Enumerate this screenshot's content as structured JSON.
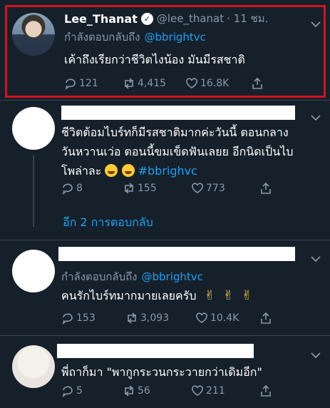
{
  "tweets": [
    {
      "name": "Lee_Thanat",
      "handle": "@lee_thanat",
      "time": "· 11 ชม.",
      "replying_prefix": "กำลังตอบกลับถึง",
      "replying_to": "@bbrightvc",
      "text": "เค้าถึงเรียกว่าชีวิตไงน้อง มันมีรสชาติ",
      "replies": "121",
      "retweets": "4,415",
      "likes": "16.8K"
    },
    {
      "text_line1": "ชีวิตต้อมไบร์ทก็มีรสชาติมากค่ะวันนี้ ตอนกลาง",
      "text_line2": "วันหวานเว่อ ตอนนี้ขมเข็ดฟันเลยย อีกนิดเป็นไบ",
      "text_line3": "โพล่าละ",
      "hashtag": "#bbrighvc",
      "replies": "8",
      "retweets": "155",
      "likes": "773",
      "more_replies": "อีก 2 การตอบกลับ"
    },
    {
      "replying_prefix": "กำลังตอบกลับถึง",
      "replying_to": "@bbrightvc",
      "text": "คนรักไบร์ทมากมายเลยครับ",
      "hand_emoji": "✌",
      "replies": "153",
      "retweets": "3,093",
      "likes": "10.4K"
    },
    {
      "text": "พี่ถาก็มา \"พากูกระวนกระวายกว่าเดิมอีก\"",
      "replies": "5",
      "retweets": "56",
      "likes": "211"
    }
  ],
  "icons": {
    "reply": "reply-icon",
    "retweet": "retweet-icon",
    "like": "heart-icon",
    "share": "share-icon",
    "caret": "chevron-down-icon",
    "verified": "verified-badge-icon"
  },
  "colors": {
    "background": "#15202b",
    "link": "#1da1f2",
    "muted": "#8899a6",
    "highlight_border": "#d3121e"
  }
}
